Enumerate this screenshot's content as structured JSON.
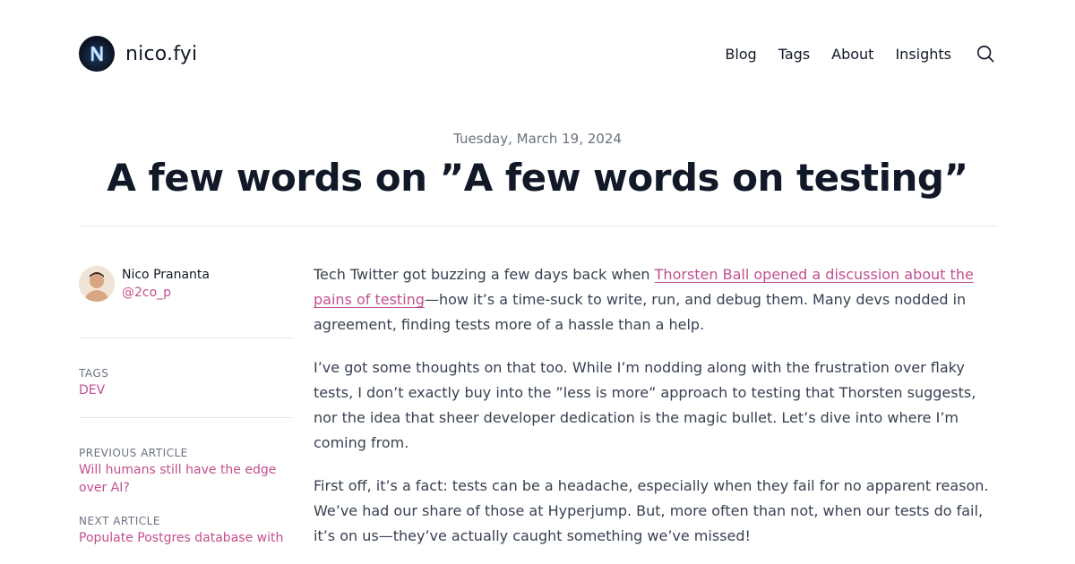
{
  "site": {
    "name": "nico.fyi",
    "logo_letter": "N"
  },
  "nav": {
    "items": [
      "Blog",
      "Tags",
      "About",
      "Insights"
    ]
  },
  "post": {
    "date": "Tuesday, March 19, 2024",
    "title": "A few words on ”A few words on testing”"
  },
  "author": {
    "name": "Nico Prananta",
    "handle": "@2co_p"
  },
  "tags": {
    "label": "TAGS",
    "items": [
      "DEV"
    ]
  },
  "previous": {
    "label": "PREVIOUS ARTICLE",
    "title": "Will humans still have the edge over AI?"
  },
  "next": {
    "label": "NEXT ARTICLE",
    "title": "Populate Postgres database with"
  },
  "article": {
    "p1_before": "Tech Twitter got buzzing a few days back when ",
    "p1_link": "Thorsten Ball opened a discussion about the pains of testing",
    "p1_after": "—how it’s a time-suck to write, run, and debug them. Many devs nodded in agreement, finding tests more of a hassle than a help.",
    "p2": "I’ve got some thoughts on that too. While I’m nodding along with the frustration over flaky tests, I don’t exactly buy into the ”less is more” approach to testing that Thorsten suggests, nor the idea that sheer developer dedication is the magic bullet. Let’s dive into where I’m coming from.",
    "p3": "First off, it’s a fact: tests can be a headache, especially when they fail for no apparent reason. We’ve had our share of those at Hyperjump. But, more often than not, when our tests do fail, it’s on us—they’ve actually caught something we’ve missed!"
  },
  "colors": {
    "accent": "#c24e8d",
    "text": "#111827",
    "muted": "#6b7280",
    "border": "#e5e7eb"
  },
  "icons": {
    "search": "search-icon",
    "logo": "logo-icon"
  }
}
